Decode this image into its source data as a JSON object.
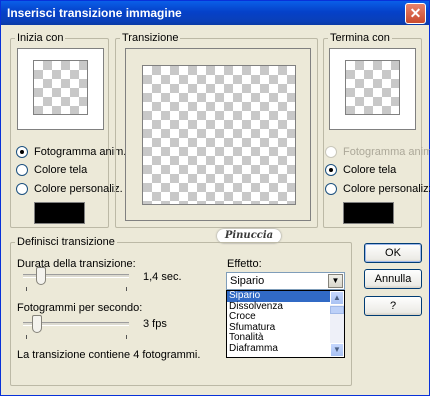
{
  "window": {
    "title": "Inserisci transizione immagine",
    "close_glyph": "✕"
  },
  "start_group": {
    "legend": "Inizia con",
    "options": [
      {
        "label": "Fotogramma anim.",
        "selected": true,
        "enabled": true
      },
      {
        "label": "Colore tela",
        "selected": false,
        "enabled": true
      },
      {
        "label": "Colore personaliz.",
        "selected": false,
        "enabled": true
      }
    ],
    "custom_color": "#000000"
  },
  "transition_group": {
    "legend": "Transizione"
  },
  "end_group": {
    "legend": "Termina con",
    "options": [
      {
        "label": "Fotogramma anim.",
        "selected": false,
        "enabled": false
      },
      {
        "label": "Colore tela",
        "selected": true,
        "enabled": true
      },
      {
        "label": "Colore personalizz.",
        "selected": false,
        "enabled": true
      }
    ],
    "custom_color": "#000000"
  },
  "watermark": "Pinuccia",
  "define_group": {
    "legend": "Definisci transizione",
    "duration_label": "Durata della transizione:",
    "duration_value": "1,4 sec.",
    "fps_label": "Fotogrammi per secondo:",
    "fps_value": "3 fps",
    "info": "La transizione contiene 4 fotogrammi."
  },
  "effect": {
    "label": "Effetto:",
    "selected": "Sipario",
    "options": [
      "Sipario",
      "Dissolvenza",
      "Croce",
      "Sfumatura",
      "Tonalità",
      "Diaframma"
    ]
  },
  "buttons": {
    "ok": "OK",
    "cancel": "Annulla",
    "help": "?"
  },
  "colors": {
    "titlebar": "#0a4fd6",
    "selection": "#316ac5",
    "face": "#ece9d8"
  }
}
